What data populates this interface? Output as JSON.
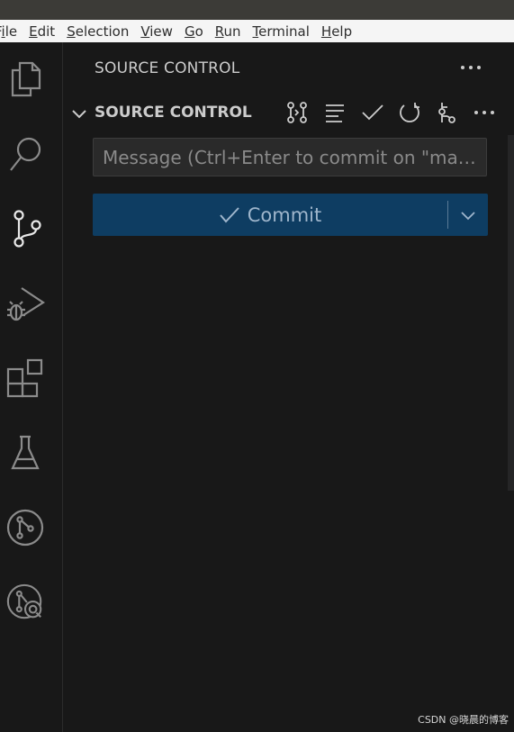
{
  "menubar": {
    "items": [
      {
        "label": "File"
      },
      {
        "label": "Edit"
      },
      {
        "label": "Selection"
      },
      {
        "label": "View"
      },
      {
        "label": "Go"
      },
      {
        "label": "Run"
      },
      {
        "label": "Terminal"
      },
      {
        "label": "Help"
      }
    ]
  },
  "activity_bar": {
    "items": [
      {
        "icon": "files-icon",
        "active": false
      },
      {
        "icon": "search-icon",
        "active": false
      },
      {
        "icon": "source-control-icon",
        "active": true
      },
      {
        "icon": "run-debug-icon",
        "active": false
      },
      {
        "icon": "extensions-icon",
        "active": false
      },
      {
        "icon": "testing-icon",
        "active": false
      },
      {
        "icon": "git-graph-icon",
        "active": false
      },
      {
        "icon": "gitlens-inspect-icon",
        "active": false
      }
    ]
  },
  "sidebar": {
    "title": "SOURCE CONTROL",
    "section": {
      "title": "SOURCE CONTROL",
      "toolbar": [
        "compare-changes-icon",
        "view-as-list-icon",
        "commit-check-icon",
        "refresh-icon",
        "branch-graph-icon",
        "more-actions-icon"
      ]
    },
    "commit_message": {
      "placeholder": "Message (Ctrl+Enter to commit on \"ma…",
      "value": ""
    },
    "commit_button": {
      "label": "Commit"
    }
  },
  "watermark": "CSDN @晓晨的博客",
  "colors": {
    "background": "#181818",
    "commit_button": "#0e3d62",
    "menubar": "#f5f5f5"
  }
}
